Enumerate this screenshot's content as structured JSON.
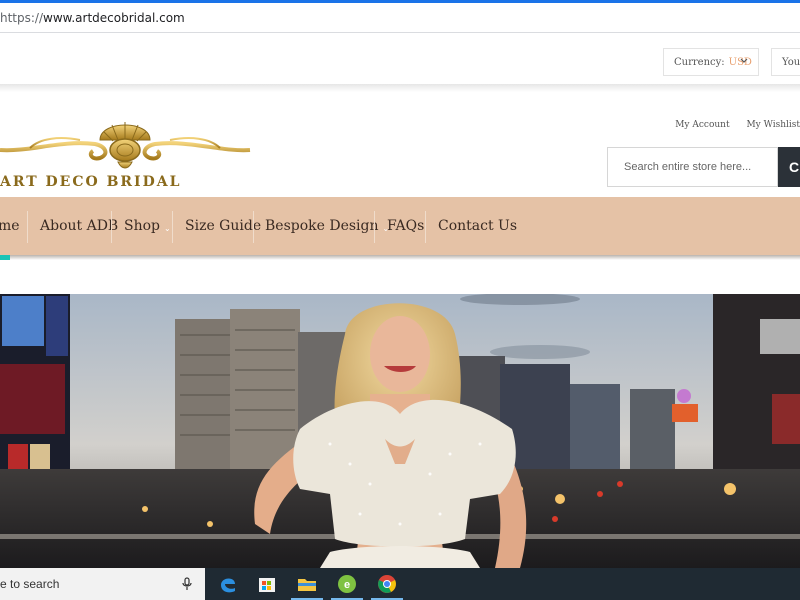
{
  "browser": {
    "url_scheme": "https://",
    "url_host": "www.artdecobridal.com"
  },
  "topbar": {
    "currency_label": "Currency:",
    "currency_code": "USD",
    "your_label": "Your"
  },
  "header": {
    "logo_text": "ART DECO BRIDAL",
    "account_links": [
      "My Account",
      "My Wishlist"
    ],
    "search_placeholder": "Search entire store here...",
    "search_button_glyph": "C"
  },
  "nav": {
    "items": [
      {
        "label": "me"
      },
      {
        "label": "About ADB"
      },
      {
        "label": "Shop"
      },
      {
        "label": "Size Guide"
      },
      {
        "label": "Bespoke Design"
      },
      {
        "label": "FAQs"
      },
      {
        "label": "Contact Us"
      }
    ],
    "dropdown_glyph": "⌄"
  },
  "taskbar": {
    "search_placeholder": "e to search"
  },
  "colors": {
    "nav_bg": "#e5c2a6",
    "accent_teal": "#1bc4b6",
    "currency_code": "#e8a070",
    "logo_gold": "#8a6a1c"
  },
  "icons": [
    "chevron-down-icon",
    "search-icon",
    "microphone-icon",
    "edge-icon",
    "store-icon",
    "file-explorer-icon",
    "dreamweaver-icon",
    "chrome-icon"
  ]
}
